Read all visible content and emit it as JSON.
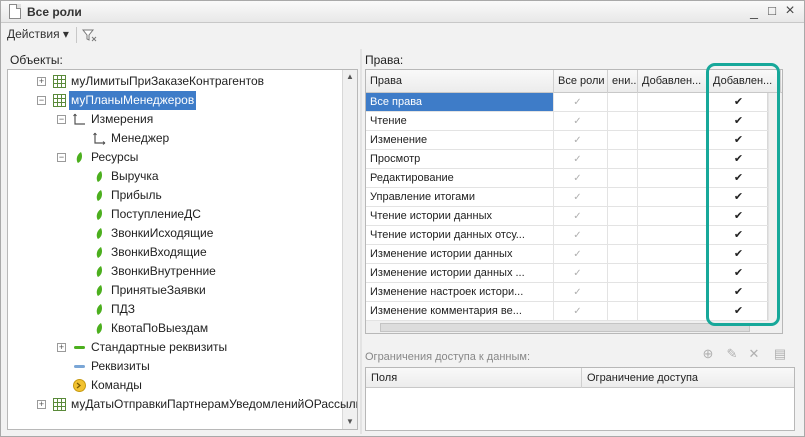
{
  "window": {
    "title": "Все роли",
    "btn_minimize": "_",
    "btn_maximize": "□",
    "btn_close": "×"
  },
  "toolbar": {
    "actions_label": "Действия ▾"
  },
  "left": {
    "label": "Объекты:",
    "tree": [
      {
        "label": "муЛимитыПриЗаказеКонтрагентов",
        "icon": "register-icon",
        "level": 0,
        "expander": "+"
      },
      {
        "label": "муПланыМенеджеров",
        "icon": "register-icon",
        "level": 0,
        "expander": "−",
        "selected": true
      },
      {
        "label": "Измерения",
        "icon": "dimensions-icon",
        "level": 1,
        "expander": "−"
      },
      {
        "label": "Менеджер",
        "icon": "dimension-icon",
        "level": 2
      },
      {
        "label": "Ресурсы",
        "icon": "resources-icon",
        "level": 1,
        "expander": "−"
      },
      {
        "label": "Выручка",
        "icon": "resource-icon",
        "level": 2
      },
      {
        "label": "Прибыль",
        "icon": "resource-icon",
        "level": 2
      },
      {
        "label": "ПоступлениеДС",
        "icon": "resource-icon",
        "level": 2
      },
      {
        "label": "ЗвонкиИсходящие",
        "icon": "resource-icon",
        "level": 2
      },
      {
        "label": "ЗвонкиВходящие",
        "icon": "resource-icon",
        "level": 2
      },
      {
        "label": "ЗвонкиВнутренние",
        "icon": "resource-icon",
        "level": 2
      },
      {
        "label": "ПринятыеЗаявки",
        "icon": "resource-icon",
        "level": 2
      },
      {
        "label": "ПДЗ",
        "icon": "resource-icon",
        "level": 2
      },
      {
        "label": "КвотаПоВыездам",
        "icon": "resource-icon",
        "level": 2
      },
      {
        "label": "Стандартные реквизиты",
        "icon": "std-attributes-icon",
        "level": 1,
        "expander": "+"
      },
      {
        "label": "Реквизиты",
        "icon": "attributes-icon",
        "level": 1
      },
      {
        "label": "Команды",
        "icon": "commands-icon",
        "level": 1
      },
      {
        "label": "муДатыОтправкиПартнерамУведомленийОРассылке",
        "icon": "register-icon",
        "level": 0,
        "expander": "+"
      }
    ]
  },
  "rights": {
    "label": "Права:",
    "columns": [
      "Права",
      "Все роли",
      "ени...",
      "Добавлен...",
      "Добавлен..."
    ],
    "rows": [
      {
        "name": "Все права",
        "selected": true
      },
      {
        "name": "Чтение"
      },
      {
        "name": "Изменение"
      },
      {
        "name": "Просмотр"
      },
      {
        "name": "Редактирование"
      },
      {
        "name": "Управление итогами"
      },
      {
        "name": "Чтение истории данных"
      },
      {
        "name": "Чтение истории данных отсу..."
      },
      {
        "name": "Изменение истории данных"
      },
      {
        "name": "Изменение истории данных ..."
      },
      {
        "name": "Изменение настроек истори..."
      },
      {
        "name": "Изменение комментария ве..."
      }
    ],
    "check_mark": "✔",
    "disabled_check_mark": "✓"
  },
  "restrictions": {
    "label": "Ограничения доступа к данным:",
    "columns": [
      "Поля",
      "Ограничение доступа"
    ]
  },
  "colors": {
    "accent": "#17a89a",
    "selection": "#3e7cc8",
    "resource_green": "#4caf1e"
  }
}
